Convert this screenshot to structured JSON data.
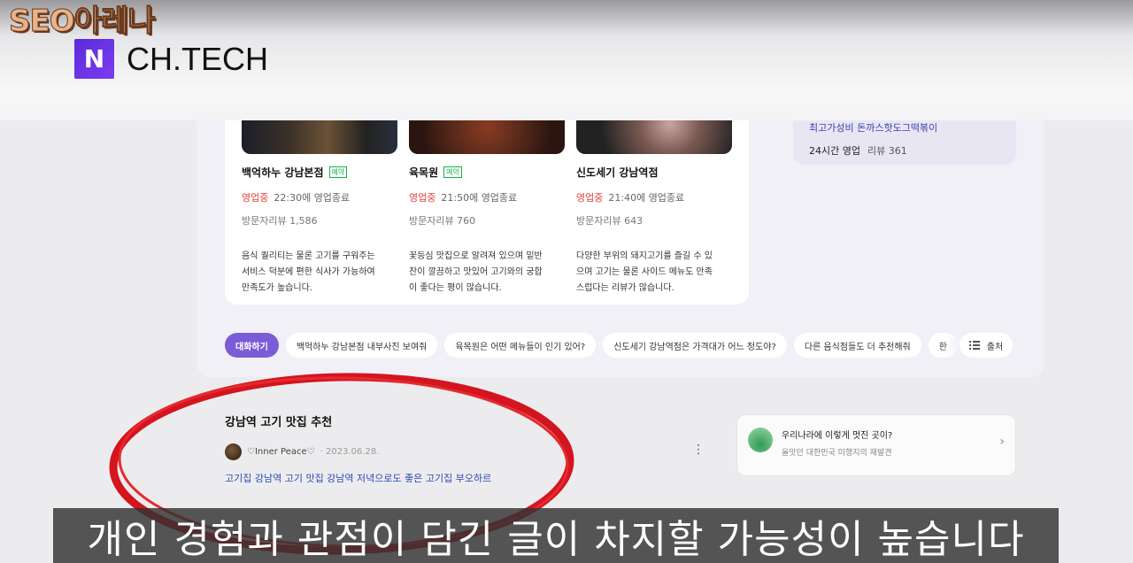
{
  "video": {
    "channel_name": "SEO아레나",
    "brand_logo_letter": "N",
    "brand_text": "CH.TECH",
    "subtitle": "개인 경험과 관점이 담긴 글이 차지할 가능성이 높습니다"
  },
  "restaurants": [
    {
      "name": "백억하누 강남본점",
      "badge": "예약",
      "status": "영업중",
      "hours": "22:30에 영업종료",
      "reviews": "방문자리뷰 1,586",
      "desc_lines": [
        "음식 퀄리티는 물론 고기를 구워주는",
        "서비스 덕분에 편한 식사가 가능하여",
        "만족도가 높습니다."
      ]
    },
    {
      "name": "육목원",
      "badge": "예약",
      "status": "영업중",
      "hours": "21:50에 영업종료",
      "reviews": "방문자리뷰 760",
      "desc_lines": [
        "꽃등심 맛집으로 알려져 있으며 밑반",
        "찬이 깔끔하고 맛있어 고기와의 궁합",
        "이 좋다는 평이 많습니다."
      ]
    },
    {
      "name": "신도세기 강남역점",
      "badge": "",
      "status": "영업중",
      "hours": "21:40에 영업종료",
      "reviews": "방문자리뷰 643",
      "desc_lines": [
        "다양한 부위의 돼지고기를 즐길 수 있",
        "으며 고기는 물론 사이드 메뉴도 만족",
        "스럽다는 리뷰가 많습니다."
      ]
    }
  ],
  "side_card": {
    "line1": "최고가성비 돈까스핫도그떡볶이",
    "line2_bold": "24시간 영업",
    "line2_rest": "리뷰 361"
  },
  "chips": {
    "primary": "대화하기",
    "items": [
      "백억하누 강남본점 내부사진 보여줘",
      "육목원은 어떤 메뉴들이 인기 있어?",
      "신도세기 강남역점은 가격대가 어느 정도야?",
      "다른 음식점들도 더 추천해줘",
      "한"
    ],
    "menu_icon": "list-icon",
    "menu_label": "출처"
  },
  "result": {
    "title": "강남역 고기 맛집 추천",
    "author": "♡Inner Peace♡",
    "date": "2023.06.28.",
    "snippet": "고기집 강남역 고기 맛집 강남역 저녁으로도 좋은 고기집 부오하르"
  },
  "promo": {
    "title": "우리나라에 이렇게 멋진 곳이?",
    "sub": "올맛던 대한민국 미행지의 재발견"
  },
  "colors": {
    "accent_purple": "#7b5cd6",
    "open_red": "#e0433a",
    "link_blue": "#2a4ab8",
    "annotation_red": "#d4141e"
  }
}
